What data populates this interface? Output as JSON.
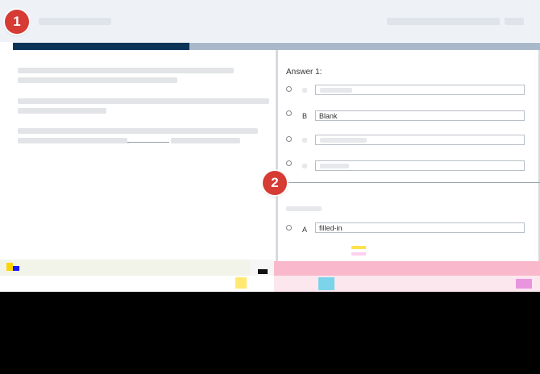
{
  "markers": [
    "1",
    "2"
  ],
  "progress": {
    "fraction": 0.335,
    "fill_color": "#0c3458",
    "track_color": "#a9b9c9"
  },
  "answers": [
    {
      "title": "Answer 1:",
      "options": [
        {
          "letter": "",
          "value": "",
          "faded": true
        },
        {
          "letter": "B",
          "value": "Blank",
          "faded": false
        },
        {
          "letter": "",
          "value": "",
          "faded": true
        },
        {
          "letter": "",
          "value": "",
          "faded": true
        }
      ]
    },
    {
      "title": "",
      "options": [
        {
          "letter": "A",
          "value": "filled-in",
          "faded": false
        }
      ]
    }
  ],
  "colors": {
    "marker": "#d63b34",
    "header_bg": "#eef2f7"
  }
}
